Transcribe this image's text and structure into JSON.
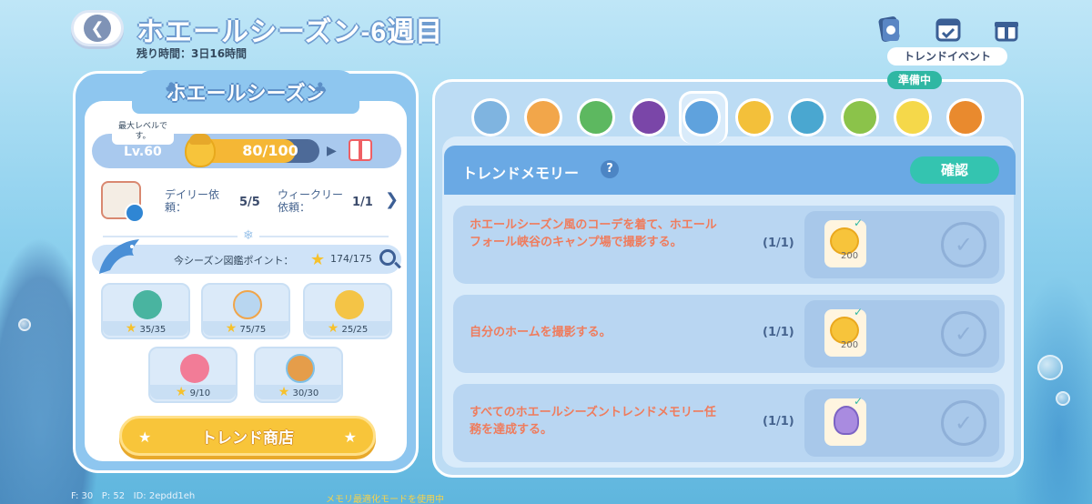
{
  "header": {
    "title": "ホエールシーズン-6週目",
    "time_left": "残り時間：3日16時間",
    "trend_event_label": "トレンドイベント",
    "status_badge": "準備中"
  },
  "left": {
    "season_title": "ホエールシーズン",
    "max_level_note": "最大レベルです。",
    "level": "Lv.60",
    "progress_text": "80/100",
    "progress_fraction": 0.8,
    "daily_label": "デイリー依頼：",
    "daily_value": "5/5",
    "weekly_label": "ウィークリー依頼：",
    "weekly_value": "1/1",
    "points_label": "今シーズン図鑑ポイント：",
    "points_value": "174/175",
    "collections": [
      {
        "icon": "bird-icon",
        "value": "35/35",
        "color": "#49b4a0"
      },
      {
        "icon": "fish-bowl-icon",
        "value": "75/75",
        "color": "#b8d6f0"
      },
      {
        "icon": "butterfly-icon",
        "value": "25/25",
        "color": "#f4c446"
      },
      {
        "icon": "pink-fish-icon",
        "value": "9/10",
        "color": "#f27c97"
      },
      {
        "icon": "duck-icon",
        "value": "30/30",
        "color": "#e59d4a"
      }
    ],
    "shop_button": "トレンド商店"
  },
  "right": {
    "memory_title": "トレンドメモリー",
    "help": "?",
    "confirm": "確認",
    "categories": [
      {
        "icon": "lemonade-icon",
        "color": "#7fb4e0"
      },
      {
        "icon": "bowl-icon",
        "color": "#f2a64a"
      },
      {
        "icon": "watering-can-icon",
        "color": "#5db860"
      },
      {
        "icon": "record-icon",
        "color": "#7a46a8"
      },
      {
        "icon": "photo-album-icon",
        "color": "#5fa2dd"
      },
      {
        "icon": "photos-icon",
        "color": "#f3c03a"
      },
      {
        "icon": "fish-pair-icon",
        "color": "#4aa7d0"
      },
      {
        "icon": "bird-nest-icon",
        "color": "#8bc34a"
      },
      {
        "icon": "butterfly-icon",
        "color": "#f5d84a"
      },
      {
        "icon": "book-icon",
        "color": "#e98a2e"
      }
    ],
    "tasks": [
      {
        "text": "ホエールシーズン風のコーデを着て、ホエールフォール峡谷のキャンプ場で撮影する。",
        "count": "(1/1)",
        "reward": "200",
        "reward_type": "coin"
      },
      {
        "text": "自分のホームを撮影する。",
        "count": "(1/1)",
        "reward": "200",
        "reward_type": "coin"
      },
      {
        "text": "すべてのホエールシーズントレンドメモリー任務を達成する。",
        "count": "(1/1)",
        "reward": "",
        "reward_type": "bottle"
      }
    ]
  },
  "debug": {
    "fps": "F: 30",
    "ping": "P: 52",
    "id": "ID: 2epdd1eh",
    "mode": "メモリ最適化モードを使用中"
  }
}
